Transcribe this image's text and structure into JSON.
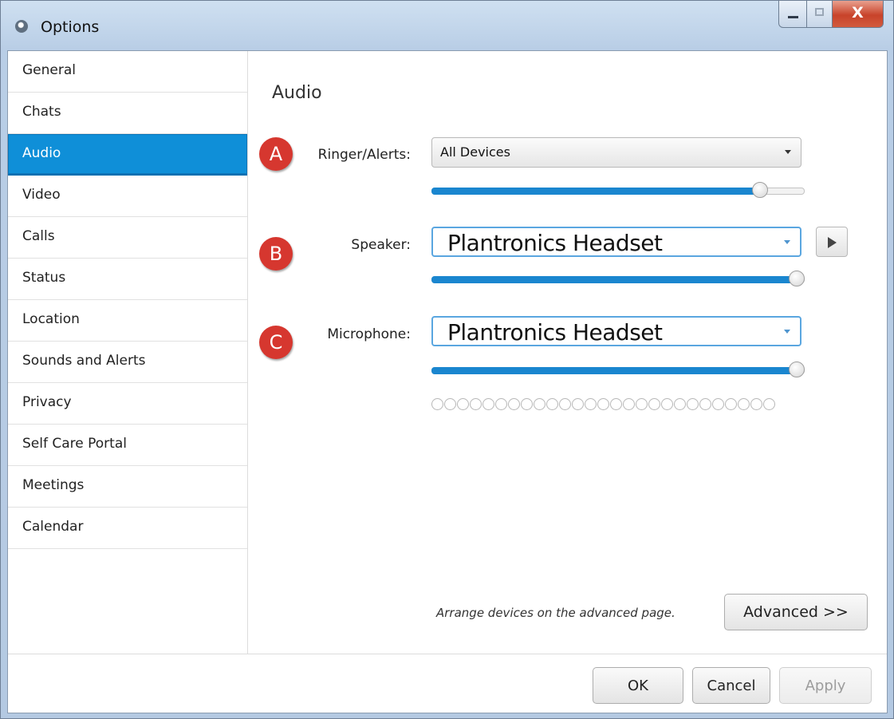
{
  "window": {
    "title": "Options",
    "close_glyph": "X"
  },
  "sidebar": {
    "items": [
      {
        "label": "General",
        "selected": false
      },
      {
        "label": "Chats",
        "selected": false
      },
      {
        "label": "Audio",
        "selected": true
      },
      {
        "label": "Video",
        "selected": false
      },
      {
        "label": "Calls",
        "selected": false
      },
      {
        "label": "Status",
        "selected": false
      },
      {
        "label": "Location",
        "selected": false
      },
      {
        "label": "Sounds and Alerts",
        "selected": false
      },
      {
        "label": "Privacy",
        "selected": false
      },
      {
        "label": "Self Care Portal",
        "selected": false
      },
      {
        "label": "Meetings",
        "selected": false
      },
      {
        "label": "Calendar",
        "selected": false
      }
    ]
  },
  "audio": {
    "title": "Audio",
    "ringer": {
      "marker": "A",
      "label": "Ringer/Alerts:",
      "value": "All Devices",
      "volume_fraction": 0.9
    },
    "speaker": {
      "marker": "B",
      "label": "Speaker:",
      "value": "Plantronics Headset",
      "volume_fraction": 1.0
    },
    "microphone": {
      "marker": "C",
      "label": "Microphone:",
      "value": "Plantronics Headset",
      "volume_fraction": 1.0,
      "level_indicators": 27,
      "level_active": 0
    },
    "advanced_hint": "Arrange devices on the advanced page.",
    "advanced_button": "Advanced >>"
  },
  "footer": {
    "ok": "OK",
    "cancel": "Cancel",
    "apply": "Apply"
  },
  "colors": {
    "selection": "#0f8fd8",
    "slider_fill": "#1a86cf",
    "marker": "#d6372f"
  }
}
